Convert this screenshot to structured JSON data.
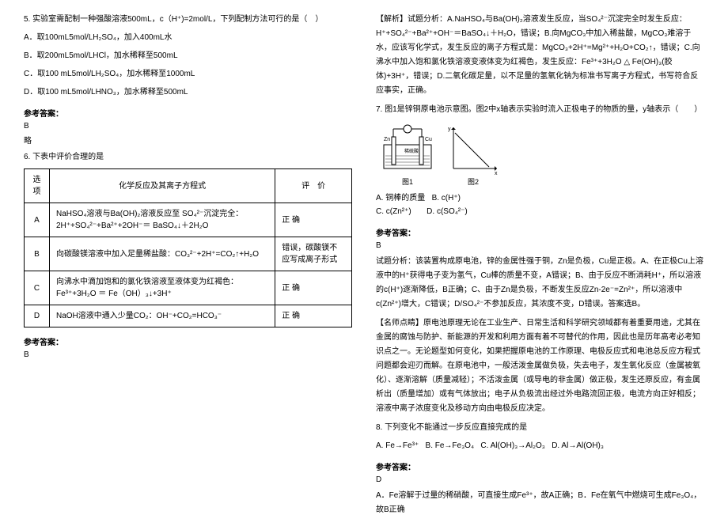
{
  "left": {
    "q5": {
      "stem": "5. 实验室需配制一种强酸溶液500mL，c（H⁺)=2mol/L，下列配制方法可行的是（　）",
      "A": "A．取100mL5mol/LH₂SO₄，加入400mL水",
      "B": "B．取200mL5mol/LHCl，加水稀释至500mL",
      "C": "C．取100 mL5mol/LH₂SO₄，加水稀释至1000mL",
      "D": "D．取100 mL5mol/LHNO₃，加水稀释至500mL",
      "refLabel": "参考答案：",
      "ans": "B",
      "note": "略"
    },
    "q6": {
      "stem": "6. 下表中评价合理的是",
      "th1": "选项",
      "th2": "化学反应及其离子方程式",
      "th3": "评　价",
      "A_opt": "A",
      "A_txt": "NaHSO₄溶液与Ba(OH)₂溶液反应至 SO₄²⁻沉淀完全：2H⁺+SO₄²⁻+Ba²⁺+2OH⁻＝ BaSO₄↓＋2H₂O",
      "A_eval": "正 确",
      "B_opt": "B",
      "B_txt": "向碳酸镁溶液中加入足量稀盐酸：CO₃²⁻+2H⁺=CO₂↑+H₂O",
      "B_eval": "错误，碳酸镁不应写成离子形式",
      "C_opt": "C",
      "C_txt": "向沸水中滴加饱和的氯化铁溶液至液体变为红褐色：Fe³⁺+3H₂O ＝ Fe（OH）₃↓+3H⁺",
      "C_eval": "正 确",
      "D_opt": "D",
      "D_txt": "NaOH溶液中通入少量CO₂：OH⁻+CO₂=HCO₃⁻",
      "D_eval": "正 确",
      "refLabel": "参考答案：",
      "ans": "B"
    }
  },
  "right": {
    "q6_analysis": "【解析】试题分析：A.NaHSO₄与Ba(OH)₂溶液发生反应，当SO₄²⁻沉淀完全时发生反应：H⁺+SO₄²⁻+Ba²⁺+OH⁻＝BaSO₄↓＋H₂O，错误；B.向MgCO₃中加入稀盐酸，MgCO₃难溶于水，应该写化学式，发生反应的离子方程式是：MgCO₃+2H⁺=Mg²⁺+H₂O+CO₂↑，错误；C.向沸水中加入饱和氯化铁溶液变液体变为红褐色，发生反应：Fe³⁺+3H₂O  △  Fe(OH)₃(胶体)+3H⁺，错误；D.二氧化碳足量，以不足量的氢氧化钠为标准书写离子方程式，书写符合反应事实，正确。",
    "q7": {
      "stem": "7. 图1是锌铜原电池示意图。图2中x轴表示实验时流入正极电子的物质的量，y轴表示（　　）",
      "fig1": "图1",
      "fig2": "图2",
      "zn": "Zn",
      "cu": "Cu",
      "acid": "稀硫酸",
      "A": "A. 铜棒的质量",
      "B": "B. c(H⁺)",
      "C": "C. c(Zn²⁺)",
      "D": "D. c(SO₄²⁻)",
      "refLabel": "参考答案：",
      "ans": "B",
      "analysis": "试题分析：该装置构成原电池，锌的金属性强于铜，Zn是负极，Cu是正极。A、在正极Cu上溶液中的H⁺获得电子变为氢气，Cu棒的质量不变，A错误；B、由于反应不断消耗H⁺，所以溶液的c(H⁺)逐渐降低，B正确；C、由于Zn是负极，不断发生反应Zn-2e⁻=Zn²⁺，所以溶液中c(Zn²⁺)增大，C错误；D/SO₄²⁻不参加反应，其浓度不变，D错误。答案选B。",
      "comment": "【名师点睛】原电池原理无论在工业生产、日常生活和科学研究领域都有着重要用途，尤其在金属的腐蚀与防护、新能源的开发和利用方面有着不可替代的作用，因此也是历年高考必考知识点之一。无论题型如何变化，如果把握原电池的工作原理、电极反应式和电池总反应方程式问题都会迎刃而解。在原电池中，一般活泼金属做负极，失去电子，发生氧化反应（金属被氧化）、逐渐溶解（质量减轻）；不活泼金属（或导电的非金属）做正极，发生还原反应，有金属析出（质量增加）或有气体放出；电子从负极流出经过外电路流回正极，电流方向正好相反；溶液中离子浓度变化及移动方向由电极反应决定。"
    },
    "q8": {
      "stem": "8. 下列变化不能通过一步反应直接完成的是",
      "A": "A. Fe→Fe³⁺",
      "B": "B. Fe→Fe₃O₄",
      "C": "C. Al(OH)₃→Al₂O₃",
      "D": "D. Al→Al(OH)₃",
      "refLabel": "参考答案：",
      "ans": "D",
      "analysis": "A．Fe溶解于过量的稀硝酸，可直接生成Fe³⁺，故A正确；B．Fe在氧气中燃烧可生成Fe₃O₄，故B正确"
    }
  }
}
